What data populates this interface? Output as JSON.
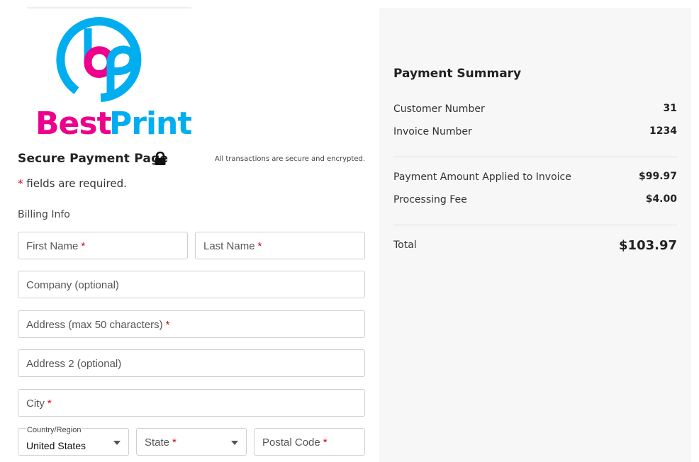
{
  "brand": {
    "name": "Best Print",
    "logo_colors": {
      "primary": "#00aeef",
      "accent": "#ec008c"
    }
  },
  "payment_page": {
    "title": "Secure Payment Page",
    "secure_note": "All transactions are secure and encrypted.",
    "required_marker": "*",
    "required_note": "fields are required.",
    "billing_section_label": "Billing Info",
    "fields": {
      "first_name": {
        "placeholder": "First Name",
        "required": "*"
      },
      "last_name": {
        "placeholder": "Last Name",
        "required": "*"
      },
      "company": {
        "placeholder": "Company (optional)"
      },
      "address": {
        "placeholder": "Address (max 50 characters)",
        "required": "*"
      },
      "address2": {
        "placeholder": "Address 2 (optional)"
      },
      "city": {
        "placeholder": "City",
        "required": "*"
      },
      "country": {
        "label": "Country/Region",
        "value": "United States"
      },
      "state": {
        "placeholder": "State",
        "required": "*"
      },
      "postal_code": {
        "placeholder": "Postal Code",
        "required": "*"
      }
    },
    "required_color": "#d0021b"
  },
  "summary": {
    "title": "Payment Summary",
    "customer_number_label": "Customer Number",
    "customer_number": "31",
    "invoice_number_label": "Invoice Number",
    "invoice_number": "1234",
    "payment_amount_label": "Payment Amount Applied to Invoice",
    "payment_amount": "$99.97",
    "processing_fee_label": "Processing Fee",
    "processing_fee": "$4.00",
    "total_label": "Total",
    "total": "$103.97"
  }
}
